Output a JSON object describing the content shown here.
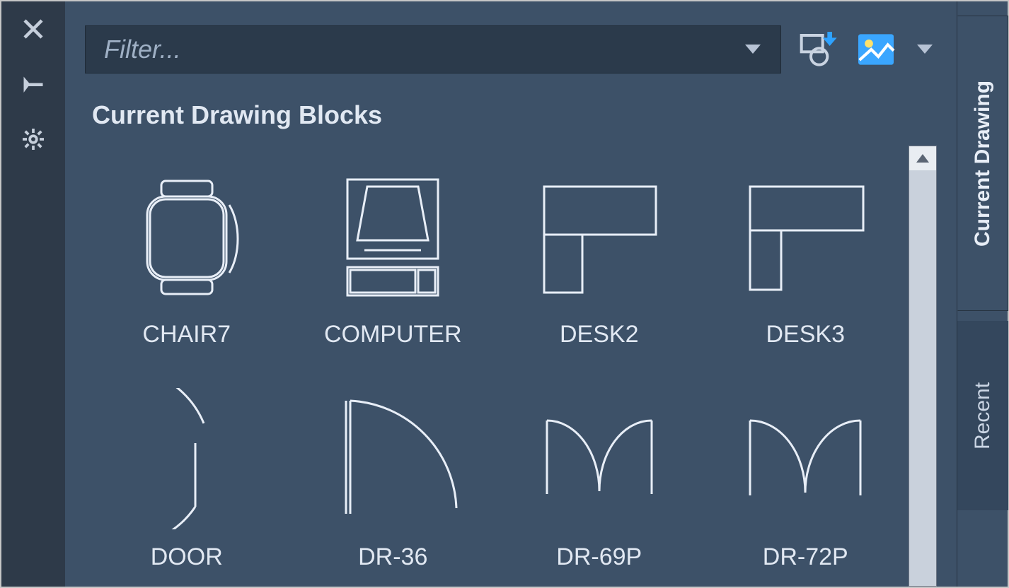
{
  "filter": {
    "placeholder": "Filter..."
  },
  "section": {
    "title": "Current Drawing Blocks"
  },
  "blocks": [
    {
      "label": "CHAIR7"
    },
    {
      "label": "COMPUTER"
    },
    {
      "label": "DESK2"
    },
    {
      "label": "DESK3"
    },
    {
      "label": "DOOR"
    },
    {
      "label": "DR-36"
    },
    {
      "label": "DR-69P"
    },
    {
      "label": "DR-72P"
    }
  ],
  "tabs": {
    "current": "Current Drawing",
    "recent": "Recent"
  }
}
